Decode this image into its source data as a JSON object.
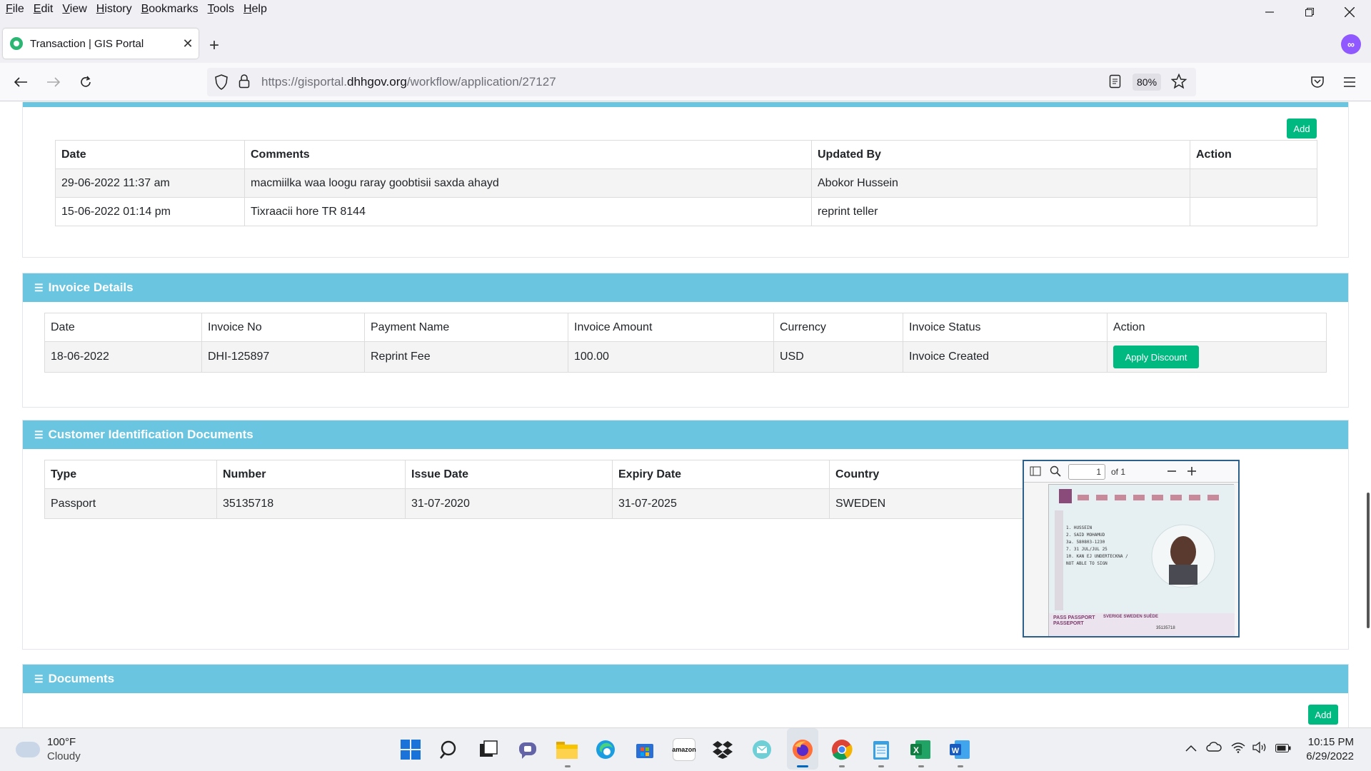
{
  "menu": {
    "items": [
      {
        "label": "File",
        "key": "F",
        "rest": "ile"
      },
      {
        "label": "Edit",
        "key": "E",
        "rest": "dit"
      },
      {
        "label": "View",
        "key": "V",
        "rest": "iew"
      },
      {
        "label": "History",
        "key": "H",
        "rest": "istory"
      },
      {
        "label": "Bookmarks",
        "key": "B",
        "rest": "ookmarks"
      },
      {
        "label": "Tools",
        "key": "T",
        "rest": "ools"
      },
      {
        "label": "Help",
        "key": "H",
        "rest": "elp"
      }
    ]
  },
  "tab": {
    "title": "Transaction | GIS Portal",
    "close": "✕"
  },
  "newtab": "+",
  "address": {
    "url_prefix": "https://gisportal.",
    "url_domain": "dhhgov.org",
    "url_suffix": "/workflow/application/27127",
    "zoom": "80%"
  },
  "comments_section": {
    "add_label": "Add",
    "headers": [
      "Date",
      "Comments",
      "Updated By",
      "Action"
    ],
    "rows": [
      {
        "date": "29-06-2022 11:37 am",
        "comment": "macmiilka waa loogu raray goobtisii saxda ahayd",
        "updated_by": "Abokor Hussein",
        "action": ""
      },
      {
        "date": "15-06-2022 01:14 pm",
        "comment": "Tixraacii hore TR 8144",
        "updated_by": "reprint teller",
        "action": ""
      }
    ]
  },
  "invoice_section": {
    "title": "Invoice Details",
    "headers": [
      "Date",
      "Invoice No",
      "Payment Name",
      "Invoice Amount",
      "Currency",
      "Invoice Status",
      "Action"
    ],
    "rows": [
      {
        "date": "18-06-2022",
        "invoice_no": "DHI-125897",
        "payment_name": "Reprint Fee",
        "amount": "100.00",
        "currency": "USD",
        "status": "Invoice Created",
        "action_label": "Apply Discount"
      }
    ]
  },
  "id_docs_section": {
    "title": "Customer Identification Documents",
    "headers": [
      "Type",
      "Number",
      "Issue Date",
      "Expiry Date",
      "Country"
    ],
    "rows": [
      {
        "type": "Passport",
        "number": "35135718",
        "issue_date": "31-07-2020",
        "expiry_date": "31-07-2025",
        "country": "SWEDEN"
      }
    ],
    "pdf_viewer": {
      "page": "1",
      "of_label": "of 1"
    },
    "passport_text": {
      "surname": "1. HUSSEIN",
      "given": "2. SAID MOHAMUD",
      "line3": "3a. 580803-1230",
      "line4": "7. 31 JUL/JUL 25",
      "line5": "10. KAN EJ UNDERTECKNA /",
      "line6": "NOT ABLE TO SIGN",
      "country_line": "SVERIGE  SWEDEN  SUÈDE",
      "pass_label": "PASS PASSPORT PASSEPORT",
      "number": "35135718"
    }
  },
  "documents_section": {
    "title": "Documents",
    "add_label": "Add"
  },
  "taskbar": {
    "temperature": "100°F",
    "condition": "Cloudy",
    "time": "10:15 PM",
    "date": "6/29/2022",
    "amazon_label": "amazon"
  },
  "colors": {
    "section_header": "#6ac5e0",
    "button_green": "#00b980",
    "browser_accent": "#9059ff"
  }
}
